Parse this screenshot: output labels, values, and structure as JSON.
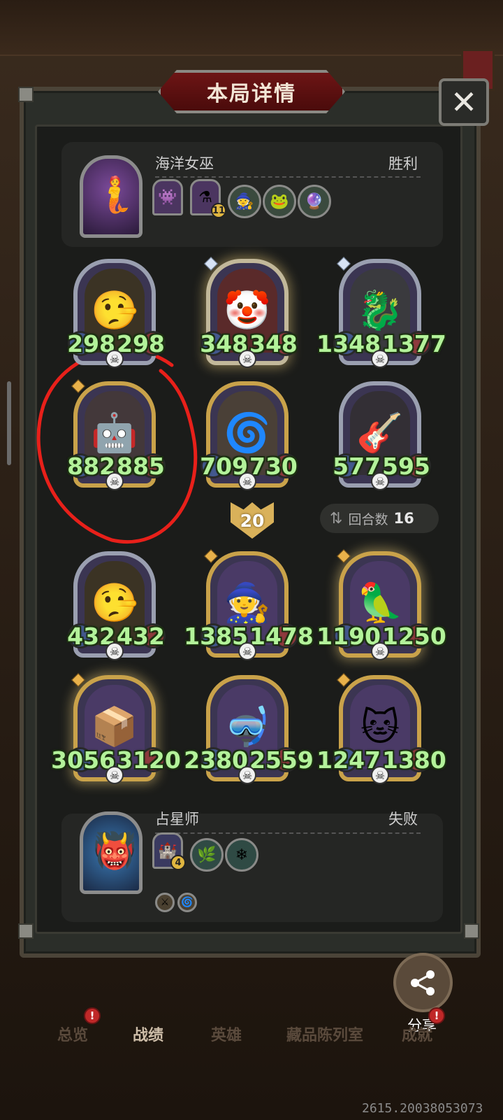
{
  "header": {
    "title": "本局详情",
    "close_label": "✕"
  },
  "winner": {
    "name": "海洋女巫",
    "result": "胜利",
    "items": [
      {
        "icon": "purple-monster-trinket-icon",
        "glyph": "👾",
        "level": ""
      },
      {
        "icon": "blue-potion-trinket-icon",
        "glyph": "⚗",
        "level": "11"
      }
    ],
    "spells": [
      {
        "icon": "old-witch-spell-icon",
        "glyph": "🧙"
      },
      {
        "icon": "green-creature-spell-icon",
        "glyph": "🐸"
      },
      {
        "icon": "teal-orb-spell-icon",
        "glyph": "🔮"
      }
    ]
  },
  "winner_board": [
    {
      "name": "pinocchio",
      "glyph": "🤥",
      "atk": "298",
      "hp": "298",
      "frame": "silver",
      "gem": "none",
      "bg": "#3b3324"
    },
    {
      "name": "jester-clown",
      "glyph": "🤡",
      "atk": "348",
      "hp": "348",
      "frame": "silverglow",
      "gem": "blue",
      "bg": "#5a2a2a"
    },
    {
      "name": "stone-dragon",
      "glyph": "🐉",
      "atk": "1348",
      "hp": "1377",
      "frame": "silver",
      "gem": "blue",
      "bg": "#3a3a3e"
    },
    {
      "name": "robot-golem",
      "glyph": "🤖",
      "atk": "882",
      "hp": "885",
      "frame": "gold",
      "gem": "gold",
      "bg": "#43383a"
    },
    {
      "name": "windmill",
      "glyph": "🌀",
      "atk": "709",
      "hp": "730",
      "frame": "gold",
      "gem": "none",
      "bg": "#4a4037"
    },
    {
      "name": "guitar-rocker",
      "glyph": "🎸",
      "atk": "577",
      "hp": "595",
      "frame": "silver",
      "gem": "none",
      "bg": "#332f35"
    }
  ],
  "turn_badge": "20",
  "rounds": {
    "icon": "swap-arrows-icon",
    "label": "回合数",
    "value": "16"
  },
  "loser_board": [
    {
      "name": "pinocchio",
      "glyph": "🤥",
      "atk": "432",
      "hp": "432",
      "frame": "silver",
      "gem": "none",
      "bg": "#3b3324"
    },
    {
      "name": "star-wizard",
      "glyph": "🧙",
      "atk": "1385",
      "hp": "1478",
      "frame": "gold",
      "gem": "gold",
      "bg": "#4a3a66"
    },
    {
      "name": "green-phoenix",
      "glyph": "🦜",
      "atk": "1190",
      "hp": "1250",
      "frame": "goldglow",
      "gem": "gold",
      "bg": "#4a3a66"
    },
    {
      "name": "clockwork-crate",
      "glyph": "📦",
      "atk": "3056",
      "hp": "3120",
      "frame": "goldglow",
      "gem": "gold",
      "bg": "#4a3a66"
    },
    {
      "name": "diving-helmet-puppet",
      "glyph": "🤿",
      "atk": "2380",
      "hp": "2559",
      "frame": "gold",
      "gem": "none",
      "bg": "#4a3a66"
    },
    {
      "name": "ghost-cat",
      "glyph": "🐱",
      "atk": "1247",
      "hp": "1380",
      "frame": "gold",
      "gem": "gold",
      "bg": "#4a3a66"
    }
  ],
  "loser": {
    "name": "占星师",
    "result": "失败",
    "items": [
      {
        "icon": "purple-tower-trinket-icon",
        "glyph": "🏰",
        "level": "4"
      }
    ],
    "spells": [
      {
        "icon": "green-vine-spell-icon",
        "glyph": "🌿"
      },
      {
        "icon": "snowflake-spell-icon",
        "glyph": "❄"
      }
    ],
    "small_items": [
      {
        "icon": "crossed-swords-icon",
        "glyph": "⚔"
      },
      {
        "icon": "gold-swirl-icon",
        "glyph": "🌀"
      }
    ]
  },
  "share": {
    "icon": "share-icon",
    "glyph": "⟨",
    "label": "分享"
  },
  "nav": [
    {
      "label": "总览",
      "active": false,
      "badge": "!"
    },
    {
      "label": "战绩",
      "active": true,
      "badge": ""
    },
    {
      "label": "英雄",
      "active": false,
      "badge": ""
    },
    {
      "label": "藏品陈列室",
      "active": false,
      "badge": ""
    },
    {
      "label": "成就",
      "active": false,
      "badge": "!"
    }
  ],
  "footer_id": "2615.20038053073",
  "colors": {
    "stat_text": "#b3f29a",
    "title_plate": "#6d1515",
    "frame_gold": "#c9a24a",
    "frame_silver": "#9a9fb0",
    "annotation": "#e8201a"
  }
}
